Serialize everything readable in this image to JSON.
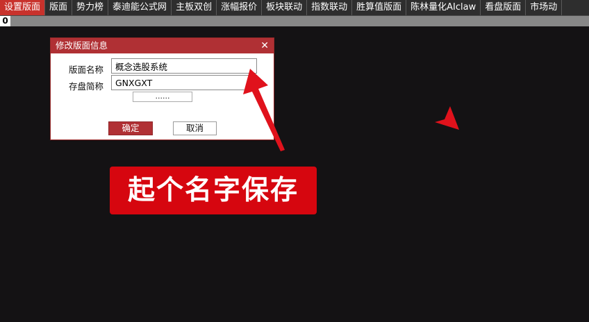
{
  "tabs": [
    {
      "label": "设置版面",
      "active": true
    },
    {
      "label": "版面",
      "active": false
    },
    {
      "label": "势力榜",
      "active": false
    },
    {
      "label": "泰迪能公式网",
      "active": false
    },
    {
      "label": "主板双创",
      "active": false
    },
    {
      "label": "涨幅报价",
      "active": false
    },
    {
      "label": "板块联动",
      "active": false
    },
    {
      "label": "指数联动",
      "active": false
    },
    {
      "label": "胜算值版面",
      "active": false
    },
    {
      "label": "陈林量化AIclaw",
      "active": false
    },
    {
      "label": "看盘版面",
      "active": false
    },
    {
      "label": "市场动",
      "active": false
    }
  ],
  "strip": {
    "cell_value": "0"
  },
  "dialog": {
    "title": "修改版面信息",
    "close_glyph": "✕",
    "name_label": "版面名称",
    "name_value": "概念选股系统",
    "short_label": "存盘简称",
    "short_value": "GNXGXT",
    "browse_label": "......",
    "ok_label": "确定",
    "cancel_label": "取消"
  },
  "annotation": {
    "banner_text": "起个名字保存",
    "arrow_color": "#e0121c",
    "banner_color": "#d6060f"
  },
  "colors": {
    "active_tab": "#c8322c",
    "dialog_title": "#b03034",
    "background": "#141214"
  }
}
